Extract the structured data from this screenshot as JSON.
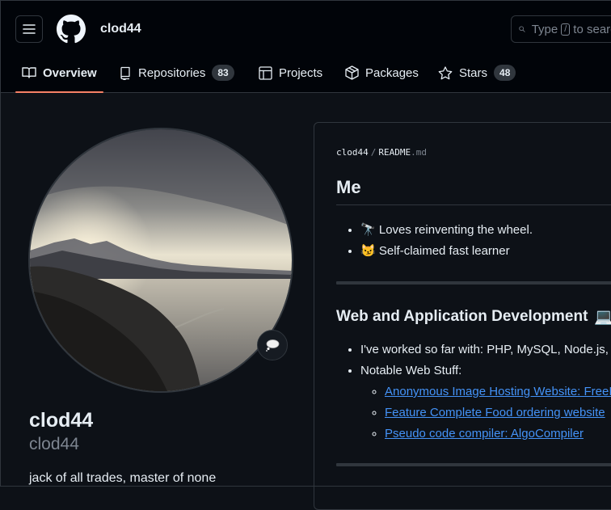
{
  "header": {
    "username": "clod44",
    "search_prefix": "Type",
    "search_key": "/",
    "search_suffix": "to search"
  },
  "tabs": [
    {
      "label": "Overview",
      "icon": "book-icon",
      "active": true
    },
    {
      "label": "Repositories",
      "icon": "repo-icon",
      "count": "83"
    },
    {
      "label": "Projects",
      "icon": "table-icon"
    },
    {
      "label": "Packages",
      "icon": "package-icon"
    },
    {
      "label": "Stars",
      "icon": "star-icon",
      "count": "48"
    }
  ],
  "profile": {
    "full_name": "clod44",
    "login": "clod44",
    "bio": "jack of all trades, master of none",
    "status_icon": "thought-balloon-icon"
  },
  "readme": {
    "owner": "clod44",
    "separator": "/",
    "file_name": "README",
    "file_ext": ".md",
    "heading": "Me",
    "me_items": [
      {
        "emoji": "🔭",
        "text": "Loves reinventing the wheel."
      },
      {
        "emoji": "😼",
        "text": "Self-claimed fast learner"
      }
    ],
    "section_heading": "Web and Application Development",
    "section_emoji": "💻",
    "worked_with": "I've worked so far with: PHP, MySQL, Node.js, Express",
    "notable_label": "Notable Web Stuff:",
    "links": [
      "Anonymous Image Hosting Website: FreeImageHost",
      "Feature Complete Food ordering website",
      "Pseudo code compiler: AlgoCompiler"
    ]
  },
  "colors": {
    "accent_underline": "#f78166",
    "link": "#4493f8",
    "background": "#0d1117"
  }
}
